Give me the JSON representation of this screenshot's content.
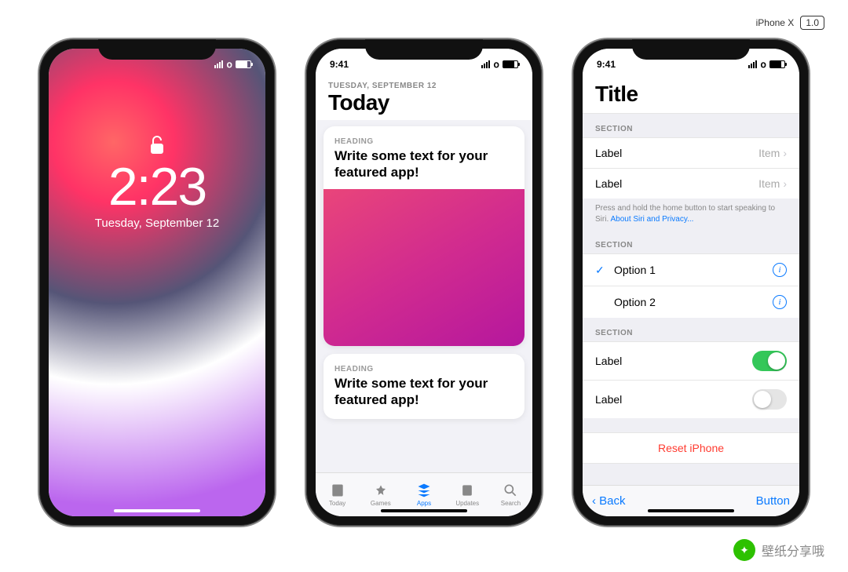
{
  "top": {
    "device": "iPhone X",
    "version": "1.0"
  },
  "status": {
    "time": "9:41"
  },
  "lock": {
    "time": "2:23",
    "date": "Tuesday, September 12"
  },
  "appstore": {
    "eyebrow": "TUESDAY, SEPTEMBER 12",
    "title": "Today",
    "cards": [
      {
        "heading": "HEADING",
        "text": "Write some text for your featured app!"
      },
      {
        "heading": "HEADING",
        "text": "Write some text for your featured app!"
      }
    ],
    "tabs": [
      {
        "label": "Today"
      },
      {
        "label": "Games"
      },
      {
        "label": "Apps"
      },
      {
        "label": "Updates"
      },
      {
        "label": "Search"
      }
    ]
  },
  "settings": {
    "title": "Title",
    "sections": [
      {
        "header": "SECTION",
        "rows": [
          {
            "label": "Label",
            "item": "Item"
          },
          {
            "label": "Label",
            "item": "Item"
          }
        ],
        "footer": "Press and hold the home button to start speaking to Siri.",
        "footerLink": "About Siri and Privacy..."
      },
      {
        "header": "SECTION",
        "options": [
          {
            "label": "Option 1",
            "checked": true
          },
          {
            "label": "Option 2",
            "checked": false
          }
        ]
      },
      {
        "header": "SECTION",
        "toggles": [
          {
            "label": "Label",
            "on": true
          },
          {
            "label": "Label",
            "on": false
          }
        ]
      }
    ],
    "reset": "Reset iPhone",
    "nav": {
      "back": "Back",
      "button": "Button"
    }
  },
  "watermark": "壁纸分享哦"
}
